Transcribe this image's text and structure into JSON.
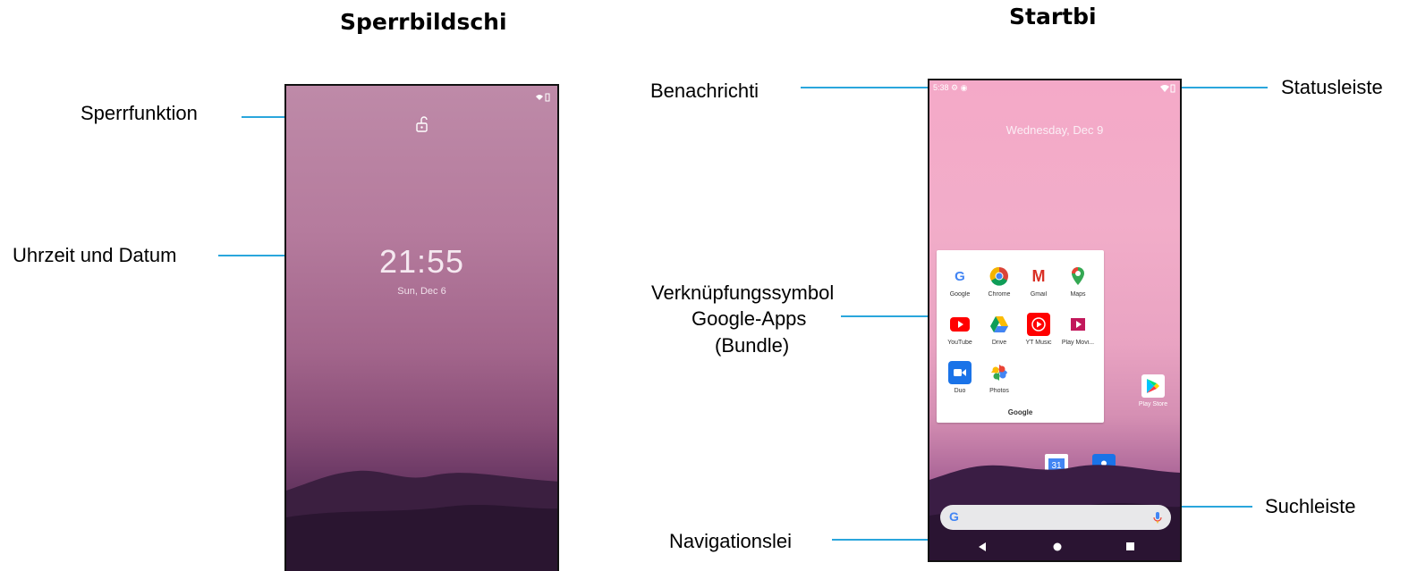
{
  "lock_screen": {
    "title": "Sperrbildschi",
    "callouts": {
      "lock": "Sperrfunktion",
      "time_date": "Uhrzeit und Datum"
    },
    "clock": "21:55",
    "date": "Sun, Dec 6"
  },
  "home_screen": {
    "title": "Startbi",
    "callouts": {
      "notifications": "Benachrichti",
      "status_bar": "Statusleiste",
      "google_apps_line1": "Verknüpfungssymbol",
      "google_apps_line2": "Google-Apps",
      "google_apps_line3": "(Bundle)",
      "search_bar": "Suchleiste",
      "navigation_bar": "Navigationslei"
    },
    "status_time": "5:38",
    "date": "Wednesday, Dec 9",
    "folder": {
      "name": "Google",
      "apps": [
        "Google",
        "Chrome",
        "Gmail",
        "Maps",
        "YouTube",
        "Drive",
        "YT Music",
        "Play Movi...",
        "Duo",
        "Photos"
      ]
    },
    "play_store_label": "Play Store",
    "calendar_day": "31",
    "search_logo": "G"
  },
  "colors": {
    "callout_line": "#2aa6dc"
  }
}
